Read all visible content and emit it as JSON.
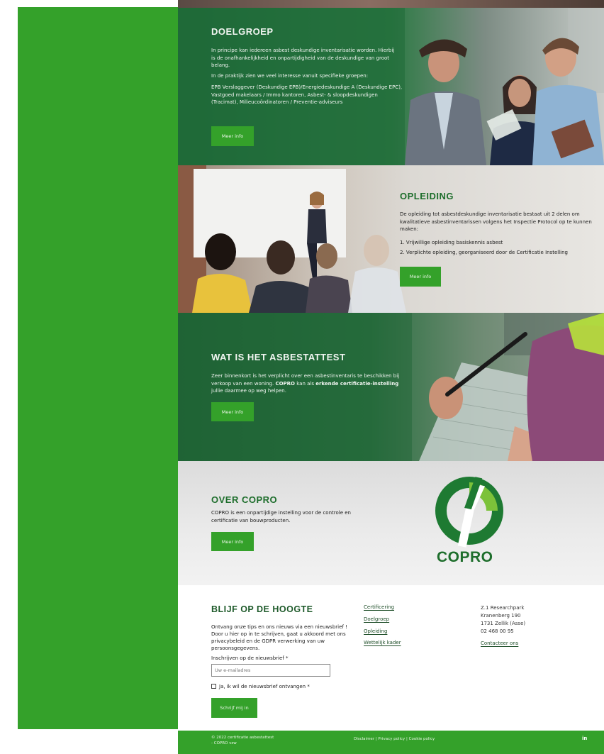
{
  "doelgroep": {
    "title": "DOELGROEP",
    "p1": "In principe kan iedereen asbest deskundige inventarisatie worden. Hierbij is de onafhankelijkheid en onpartijdigheid van de deskundige van groot belang.",
    "p2": "In de praktijk zien we veel interesse vanuit specifieke groepen:",
    "p3": "EPB Verslaggever (Deskundige EPB)/Energiedeskundige A (Deskundige EPC), Vastgoed makelaars / Immo kantoren, Asbest- & sloopdeskundigen (Tracimat), Milieucoördinatoren / Preventie-adviseurs",
    "button": "Meer info"
  },
  "opleiding": {
    "title": "OPLEIDING",
    "p1": "De opleiding tot asbestdeskundige inventarisatie bestaat uit 2 delen om kwalitatieve asbestinventarissen volgens het Inspectie Protocol op te kunnen maken:",
    "items": [
      "1. Vrijwillige opleiding basiskennis asbest",
      "2. Verplichte opleiding, georganiseerd door de Certificatie Instelling"
    ],
    "button": "Meer info"
  },
  "asbestattest": {
    "title": "WAT IS HET ASBESTATTEST",
    "p1a": "Zeer binnenkort is het verplicht over een asbestinventaris te beschikken bij verkoop van een woning. ",
    "p1b": "COPRO",
    "p1c": " kan als ",
    "p1d": "erkende certificatie-instelling",
    "p1e": " jullie daarmee op weg helpen.",
    "button": "Meer info"
  },
  "over": {
    "title": "OVER COPRO",
    "p1": "COPRO is een onpartijdige instelling voor de controle en certificatie van bouwproducten.",
    "button": "Meer info",
    "logo_text": "COPRO"
  },
  "newsletter": {
    "title": "BLIJF OP DE HOOGTE",
    "p1": "Ontvang onze tips en ons nieuws via een nieuwsbrief ! Door u hier op in te schrijven, gaat u akkoord met ons privacybeleid en de GDPR verwerking van uw persoonsgegevens.",
    "label": "Inschrijven op de nieuwsbrief *",
    "placeholder": "Uw e-mailadres",
    "checkbox": "Ja, ik wil de nieuwsbrief ontvangen *",
    "button": "Schrijf mij in"
  },
  "footer_links": [
    "Certificering",
    "Doelgroep",
    "Opleiding",
    "Wettelijk kader"
  ],
  "address": {
    "line1": "Z.1 Researchpark",
    "line2": "Kranenberg 190",
    "line3": "1731 Zellik (Asse)",
    "phone": "02 468 00 95",
    "contact": "Contacteer ons"
  },
  "bottom": {
    "copyright": "© 2022 certificatie asbestattest - COPRO vzw",
    "legal": "Disclaimer | Privacy policy | Cookie policy",
    "social": "in"
  },
  "colors": {
    "accent": "#34a12a",
    "dark_green": "#1e6e2c"
  }
}
